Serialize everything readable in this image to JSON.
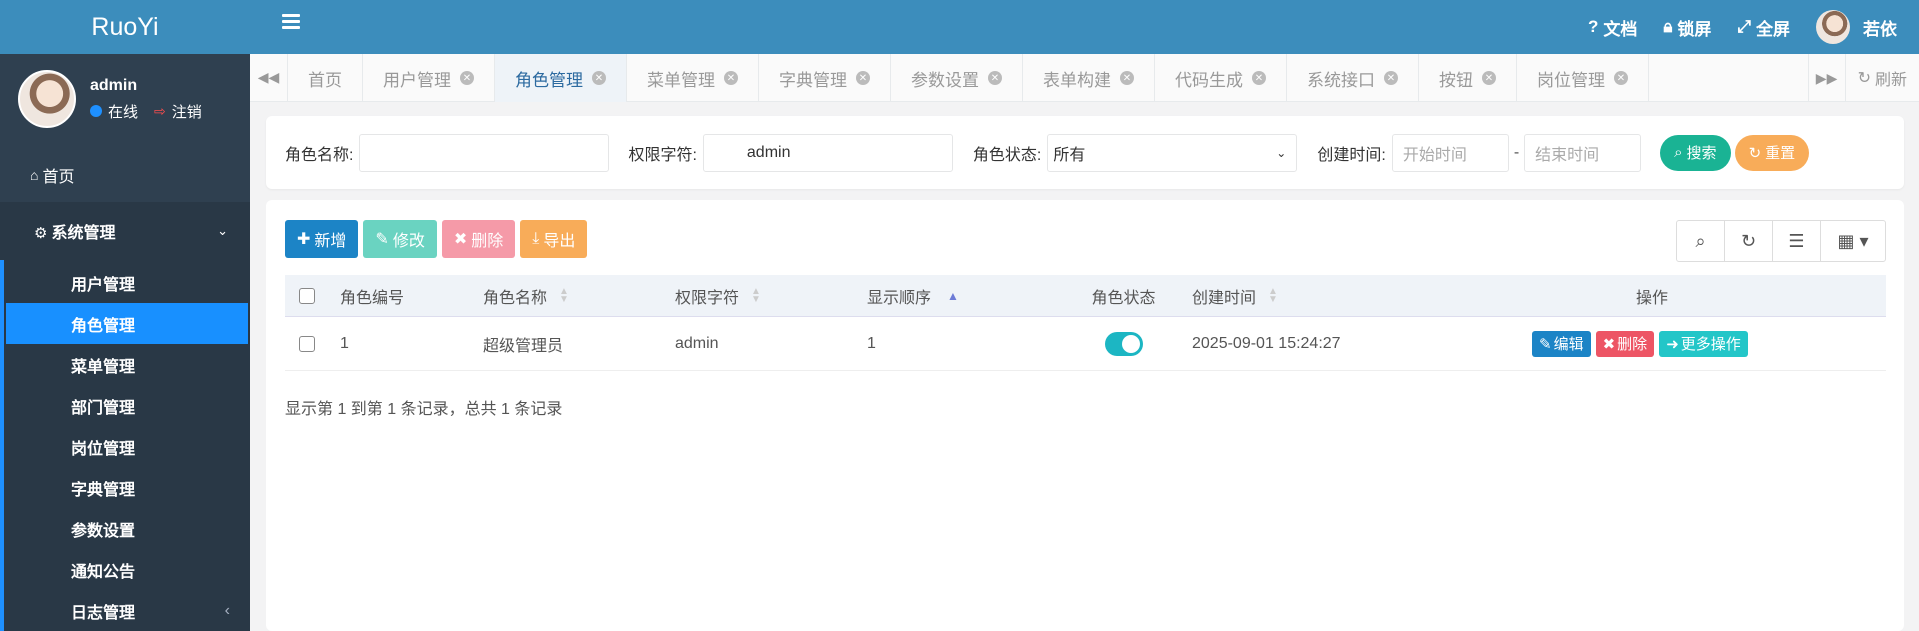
{
  "brand": "RuoYi",
  "user": {
    "name": "admin",
    "status": "在线",
    "logout": "注销"
  },
  "sidebar": {
    "home": "首页",
    "system": "系统管理",
    "items": [
      "用户管理",
      "角色管理",
      "菜单管理",
      "部门管理",
      "岗位管理",
      "字典管理",
      "参数设置",
      "通知公告",
      "日志管理"
    ]
  },
  "topbar": {
    "docs": "文档",
    "lock": "锁屏",
    "fullscreen": "全屏",
    "username": "若依"
  },
  "tabs": [
    "首页",
    "用户管理",
    "角色管理",
    "菜单管理",
    "字典管理",
    "参数设置",
    "表单构建",
    "代码生成",
    "系统接口",
    "按钮",
    "岗位管理"
  ],
  "tabs_refresh": "刷新",
  "search": {
    "role_name_label": "角色名称:",
    "role_name_value": "",
    "perm_label": "权限字符:",
    "perm_value": "admin",
    "status_label": "角色状态:",
    "status_value": "所有",
    "created_label": "创建时间:",
    "start_placeholder": "开始时间",
    "end_placeholder": "结束时间",
    "range_sep": "-",
    "search_btn": "搜索",
    "reset_btn": "重置"
  },
  "toolbar": {
    "add": "新增",
    "edit": "修改",
    "delete": "删除",
    "export": "导出"
  },
  "table": {
    "headers": [
      "角色编号",
      "角色名称",
      "权限字符",
      "显示顺序",
      "角色状态",
      "创建时间",
      "操作"
    ],
    "rows": [
      {
        "id": "1",
        "name": "超级管理员",
        "perm": "admin",
        "order": "1",
        "status_on": true,
        "created": "2025-09-01 15:24:27"
      }
    ],
    "actions": {
      "edit": "编辑",
      "delete": "删除",
      "more": "更多操作"
    }
  },
  "pager": "显示第 1 到第 1 条记录，总共 1 条记录",
  "colors": {
    "top": "#3c8dbc",
    "sidebar": "#2f4050",
    "active": "#1890ff",
    "add": "#1c84c6",
    "edit": "#6ad3c1",
    "delete": "#f59aa8",
    "export": "#f8ac59",
    "search": "#1ab394",
    "reset": "#f8ac59",
    "toggle": "#1cb6c3",
    "info": "#23c6c8",
    "danger": "#ed5565"
  }
}
